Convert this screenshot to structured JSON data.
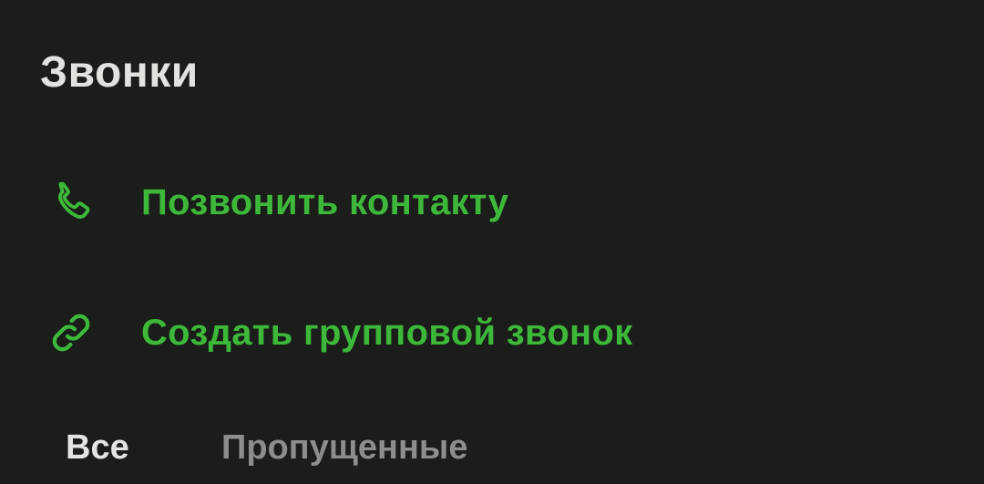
{
  "header": {
    "title": "Звонки"
  },
  "actions": [
    {
      "label": "Позвонить контакту",
      "icon": "phone-icon"
    },
    {
      "label": "Создать групповой звонок",
      "icon": "link-icon"
    }
  ],
  "tabs": [
    {
      "label": "Все",
      "selected": true
    },
    {
      "label": "Пропущенные",
      "selected": false
    }
  ],
  "colors": {
    "background": "#1a1d19",
    "accent": "#3db83a",
    "title": "#e2e3df",
    "tab_active": "#e4e5e1",
    "tab_inactive": "#8b8e89"
  }
}
